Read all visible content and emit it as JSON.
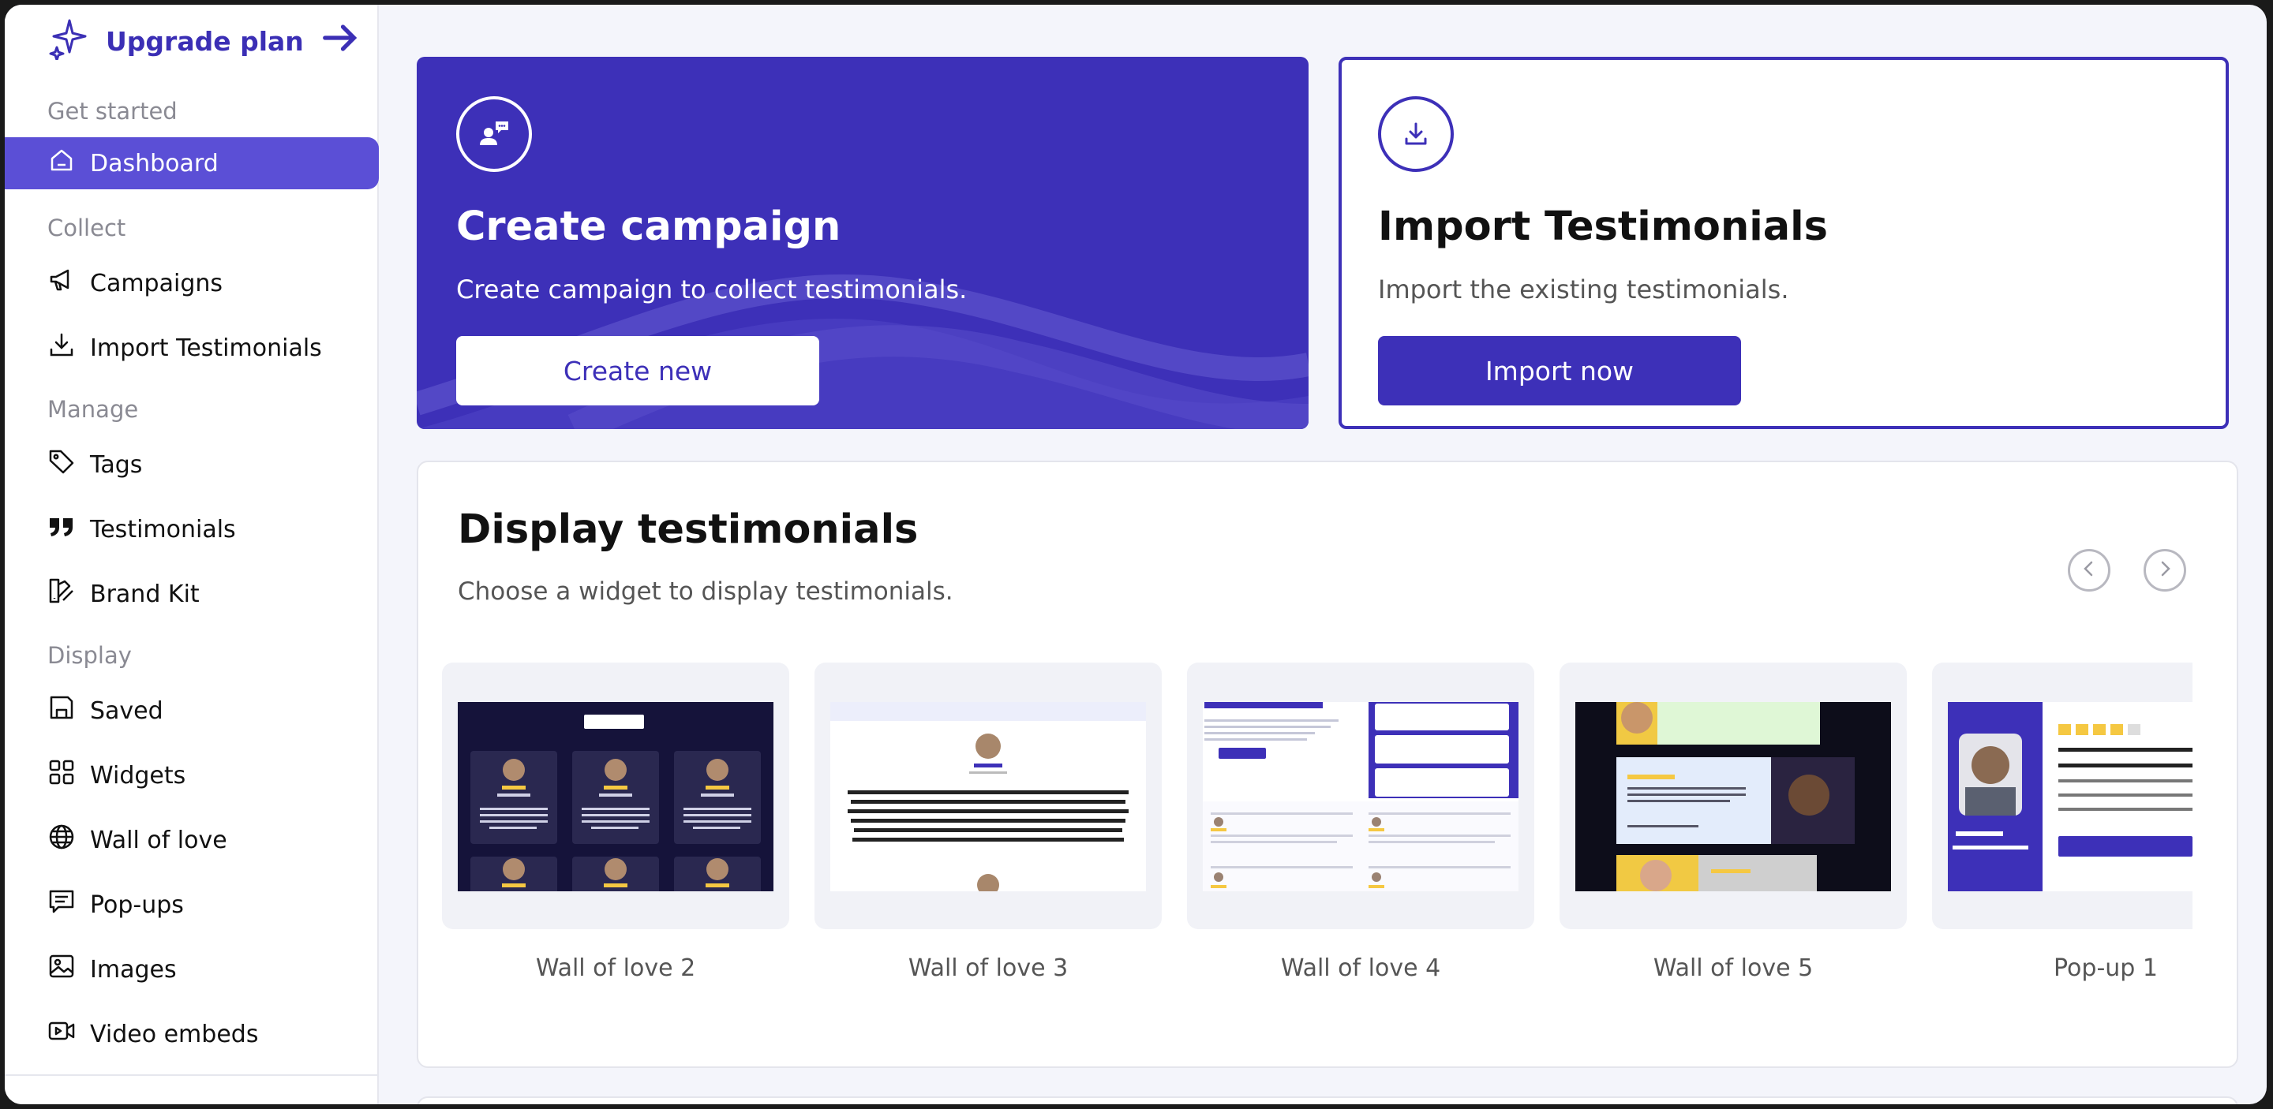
{
  "sidebar": {
    "upgrade_label": "Upgrade plan",
    "sections": {
      "get_started": "Get started",
      "collect": "Collect",
      "manage": "Manage",
      "display": "Display"
    },
    "items": {
      "dashboard": "Dashboard",
      "campaigns": "Campaigns",
      "import_testimonials": "Import Testimonials",
      "tags": "Tags",
      "testimonials": "Testimonials",
      "brand_kit": "Brand Kit",
      "saved": "Saved",
      "widgets": "Widgets",
      "wall_of_love": "Wall of love",
      "popups": "Pop-ups",
      "images": "Images",
      "video_embeds": "Video embeds"
    },
    "active_item": "dashboard"
  },
  "create_card": {
    "title": "Create campaign",
    "description": "Create campaign to collect testimonials.",
    "button": "Create new"
  },
  "import_card": {
    "title": "Import Testimonials",
    "description": "Import the existing testimonials.",
    "button": "Import now"
  },
  "display_section": {
    "title": "Display testimonials",
    "description": "Choose a widget to display testimonials.",
    "widgets": [
      {
        "label": "Wall of love 2"
      },
      {
        "label": "Wall of love 3"
      },
      {
        "label": "Wall of love 4"
      },
      {
        "label": "Wall of love 5"
      },
      {
        "label": "Pop-up 1"
      }
    ]
  },
  "colors": {
    "brand": "#3d30b8",
    "active_nav": "#5b4fd6",
    "background": "#f4f5fb"
  }
}
